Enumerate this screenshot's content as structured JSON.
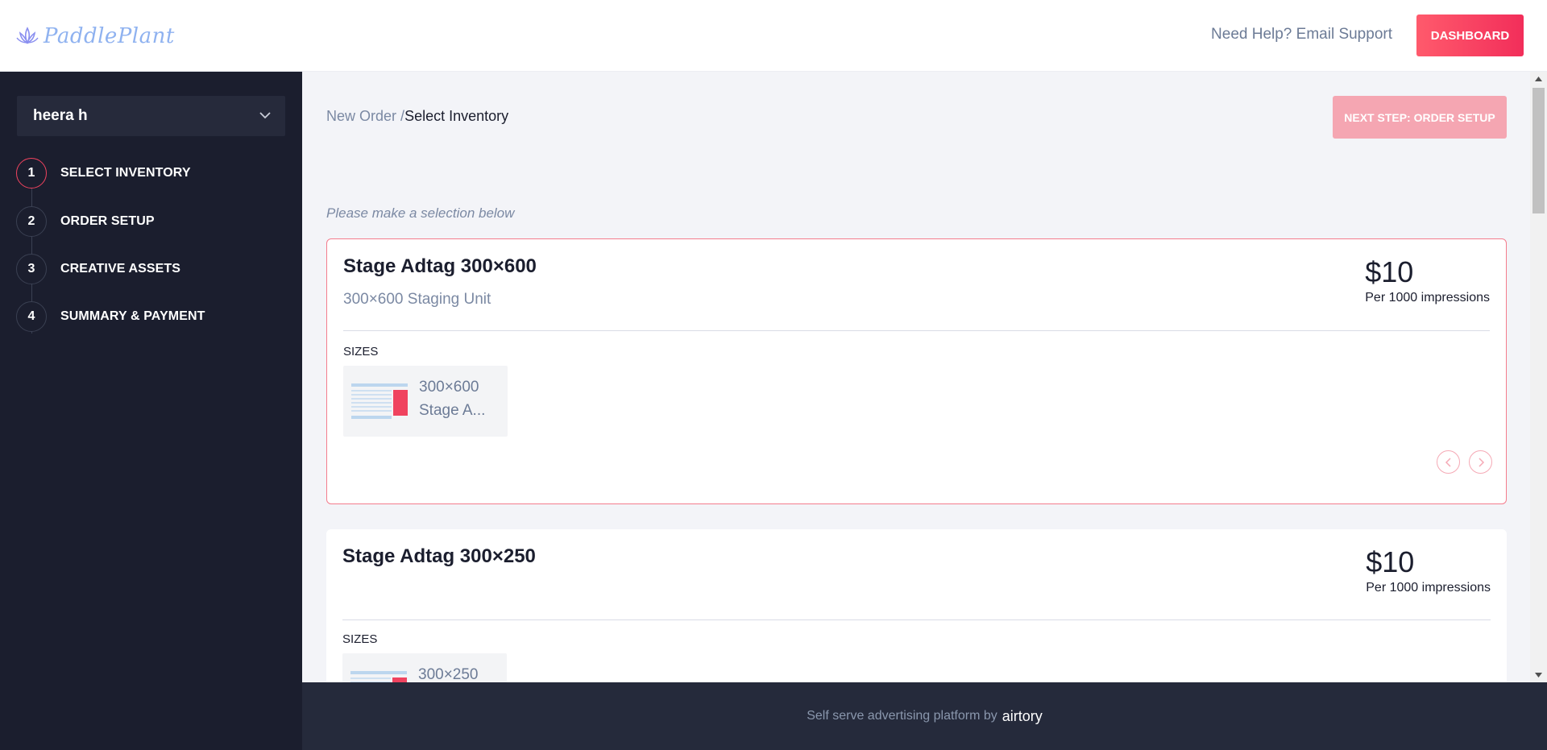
{
  "header": {
    "logo_text": "PaddlePlant",
    "help_link": "Need Help? Email Support",
    "dashboard_button": "DASHBOARD"
  },
  "sidebar": {
    "account_name": "heera h",
    "steps": [
      {
        "number": "1",
        "label": "SELECT INVENTORY",
        "active": true
      },
      {
        "number": "2",
        "label": "ORDER SETUP",
        "active": false
      },
      {
        "number": "3",
        "label": "CREATIVE ASSETS",
        "active": false
      },
      {
        "number": "4",
        "label": "SUMMARY & PAYMENT",
        "active": false
      }
    ]
  },
  "main": {
    "breadcrumb": {
      "parent": "New Order",
      "separator": "/",
      "current": "Select Inventory"
    },
    "next_button": "NEXT STEP: ORDER SETUP",
    "hint": "Please make a selection below",
    "cards": [
      {
        "title": "Stage Adtag 300×600",
        "subtitle": "300×600 Staging Unit",
        "price": "$10",
        "price_unit": "Per 1000 impressions",
        "sizes_label": "SIZES",
        "sizes": [
          {
            "dimension": "300×600",
            "name": "Stage A..."
          }
        ],
        "selected": true
      },
      {
        "title": "Stage Adtag 300×250",
        "subtitle": "",
        "price": "$10",
        "price_unit": "Per 1000 impressions",
        "sizes_label": "SIZES",
        "sizes": [
          {
            "dimension": "300×250",
            "name": ""
          }
        ],
        "selected": false
      }
    ]
  },
  "footer": {
    "text": "Self serve advertising platform by",
    "brand": "airtory"
  },
  "colors": {
    "accent": "#f22e5a",
    "sidebar_bg": "#1b1e2e",
    "main_bg": "#f3f4f8",
    "footer_bg": "#252a3b"
  }
}
